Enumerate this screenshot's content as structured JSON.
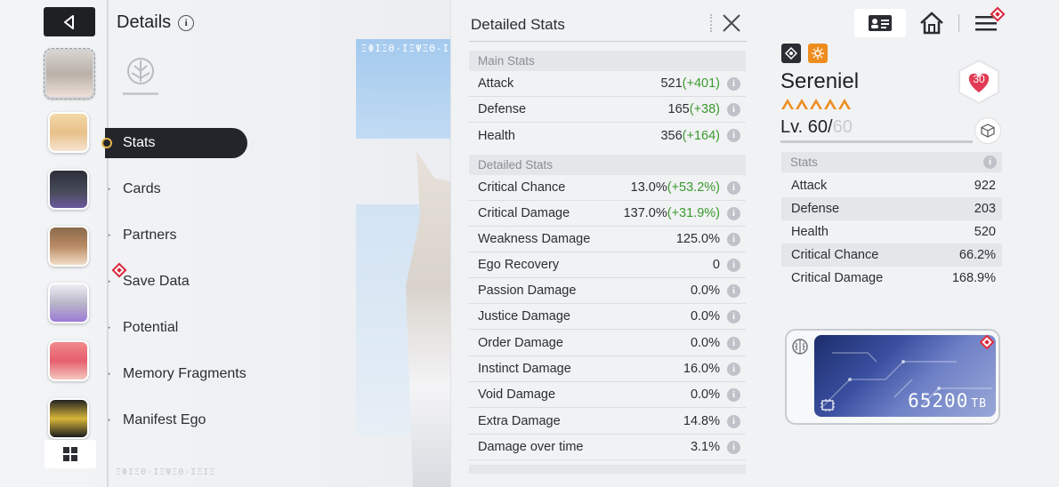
{
  "colors": {
    "bonus_green": "#3a9a2e",
    "accent_orange": "#ee8d1f",
    "alert_red": "#d9263b",
    "dark": "#23252a"
  },
  "scene": {
    "code_text": "ΞΦΙΞΘ-ΙΞΨΞΘ-ΙΞ",
    "footer_text": "ΞΦΙΞΘ-ΙΞΨΞΘ-ΙΞΙΞ"
  },
  "left": {
    "title": "Details",
    "nav": [
      {
        "label": "Stats",
        "active": true
      },
      {
        "label": "Cards"
      },
      {
        "label": "Partners"
      },
      {
        "label": "Save Data",
        "alert": true
      },
      {
        "label": "Potential"
      },
      {
        "label": "Memory Fragments"
      },
      {
        "label": "Manifest Ego"
      }
    ],
    "avatars": [
      "avatar-silver-hair",
      "avatar-blonde",
      "avatar-beast",
      "avatar-brown-hair",
      "avatar-white-hair",
      "avatar-pink-hair",
      "avatar-gold-mask"
    ]
  },
  "stats": {
    "title": "Detailed Stats",
    "main_section": "Main Stats",
    "main": [
      {
        "label": "Attack",
        "value": "521",
        "bonus": "(+401)"
      },
      {
        "label": "Defense",
        "value": "165",
        "bonus": "(+38)"
      },
      {
        "label": "Health",
        "value": "356",
        "bonus": "(+164)"
      }
    ],
    "detailed_section": "Detailed Stats",
    "detailed": [
      {
        "label": "Critical Chance",
        "value": "13.0%",
        "bonus": "(+53.2%)"
      },
      {
        "label": "Critical Damage",
        "value": "137.0%",
        "bonus": "(+31.9%)"
      },
      {
        "label": "Weakness Damage",
        "value": "125.0%",
        "bonus": ""
      },
      {
        "label": "Ego Recovery",
        "value": "0",
        "bonus": ""
      },
      {
        "label": "Passion Damage",
        "value": "0.0%",
        "bonus": ""
      },
      {
        "label": "Justice Damage",
        "value": "0.0%",
        "bonus": ""
      },
      {
        "label": "Order Damage",
        "value": "0.0%",
        "bonus": ""
      },
      {
        "label": "Instinct Damage",
        "value": "16.0%",
        "bonus": ""
      },
      {
        "label": "Void Damage",
        "value": "0.0%",
        "bonus": ""
      },
      {
        "label": "Extra Damage",
        "value": "14.8%",
        "bonus": ""
      },
      {
        "label": "Damage over time",
        "value": "3.1%",
        "bonus": ""
      }
    ]
  },
  "character": {
    "name": "Sereniel",
    "stars": 5,
    "level_prefix": "Lv. ",
    "level": "60",
    "level_sep": "/",
    "level_max": "60",
    "level_progress": 1.0,
    "affinity": "30",
    "stats_section": "Stats",
    "stats": [
      {
        "label": "Attack",
        "value": "922"
      },
      {
        "label": "Defense",
        "value": "203"
      },
      {
        "label": "Health",
        "value": "520"
      },
      {
        "label": "Critical Chance",
        "value": "66.2%"
      },
      {
        "label": "Critical Damage",
        "value": "168.9%"
      }
    ],
    "storage_value": "65200",
    "storage_unit": "TB"
  }
}
